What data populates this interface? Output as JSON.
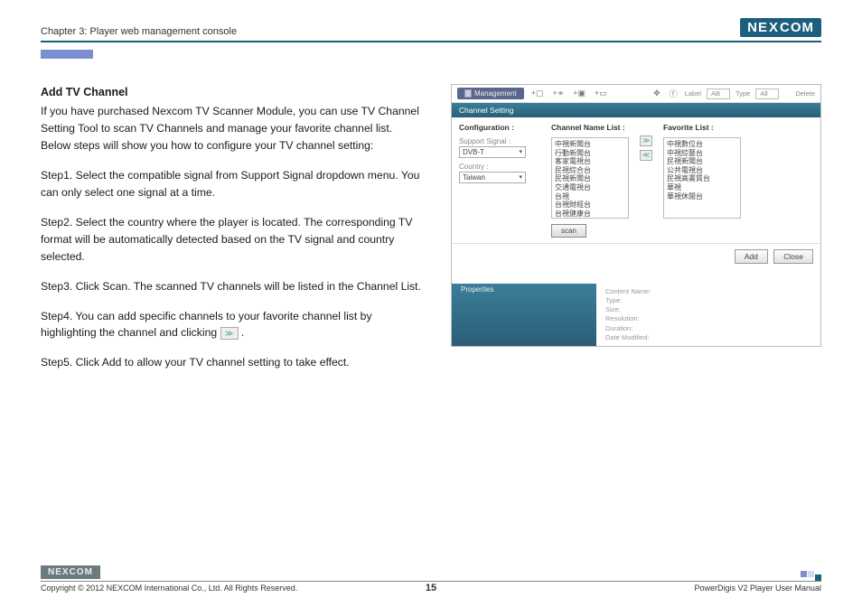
{
  "header": {
    "chapter": "Chapter 3: Player web management console",
    "brand_left": "NE",
    "brand_mid": "X",
    "brand_right": "COM"
  },
  "doc": {
    "title": "Add TV Channel",
    "intro": "If you have purchased Nexcom TV Scanner Module, you can use TV Channel Setting Tool to scan TV Channels and manage your favorite channel list. Below steps will show you how to configure your TV channel setting:",
    "step1": "Step1. Select the compatible signal from Support Signal dropdown menu. You can only select one signal at a time.",
    "step2": "Step2. Select the country where the player is located. The corresponding TV format will be automatically detected based on the TV signal and country selected.",
    "step3": "Step3. Click Scan. The scanned TV channels will be listed in the Channel List.",
    "step4a": "Step4. You can add specific channels to your favorite channel list by highlighting the channel and clicking ",
    "step4b": ".",
    "step5": "Step5. Click Add to allow your TV channel setting to take effect."
  },
  "app": {
    "mgmt": "Management",
    "toolbar": {
      "newpage": "+▢",
      "chain": "+⚭",
      "newwin": "+▣",
      "newrow": "+▭",
      "move": "✥",
      "font": "ⓕ",
      "label_label": "Label",
      "label_val": "AB",
      "type_label": "Type",
      "type_val": "All",
      "delete": "Delete"
    },
    "dialog_title": "Channel Setting",
    "cfg_h": "Configuration :",
    "names_h": "Channel Name List :",
    "fav_h": "Favorite List :",
    "signal_lbl": "Support Signal :",
    "signal_val": "DVB-T",
    "country_lbl": "Country :",
    "country_val": "Taiwan",
    "scan": "scan",
    "add": "Add",
    "close": "Close",
    "names": [
      "中視新聞台",
      "行動新聞台",
      "客家電視台",
      "民視綜合台",
      "民視新聞台",
      "交通電視台",
      "台視",
      "台視財經台",
      "台視健康台"
    ],
    "favs": [
      "中視數位台",
      "中視綜藝台",
      "民視新聞台",
      "公共電視台",
      "民視高畫質台",
      "華視",
      "華視休閒台"
    ],
    "props_title": "Properties",
    "props": {
      "f1": "Content Name:",
      "f2": "Type:",
      "f3": "Size:",
      "f4": "Resolution:",
      "f5": "Duration:",
      "f6": "Date Modified:"
    }
  },
  "footer": {
    "copyright": "Copyright © 2012 NEXCOM International Co., Ltd. All Rights Reserved.",
    "page": "15",
    "manual": "PowerDigis V2 Player User Manual"
  }
}
